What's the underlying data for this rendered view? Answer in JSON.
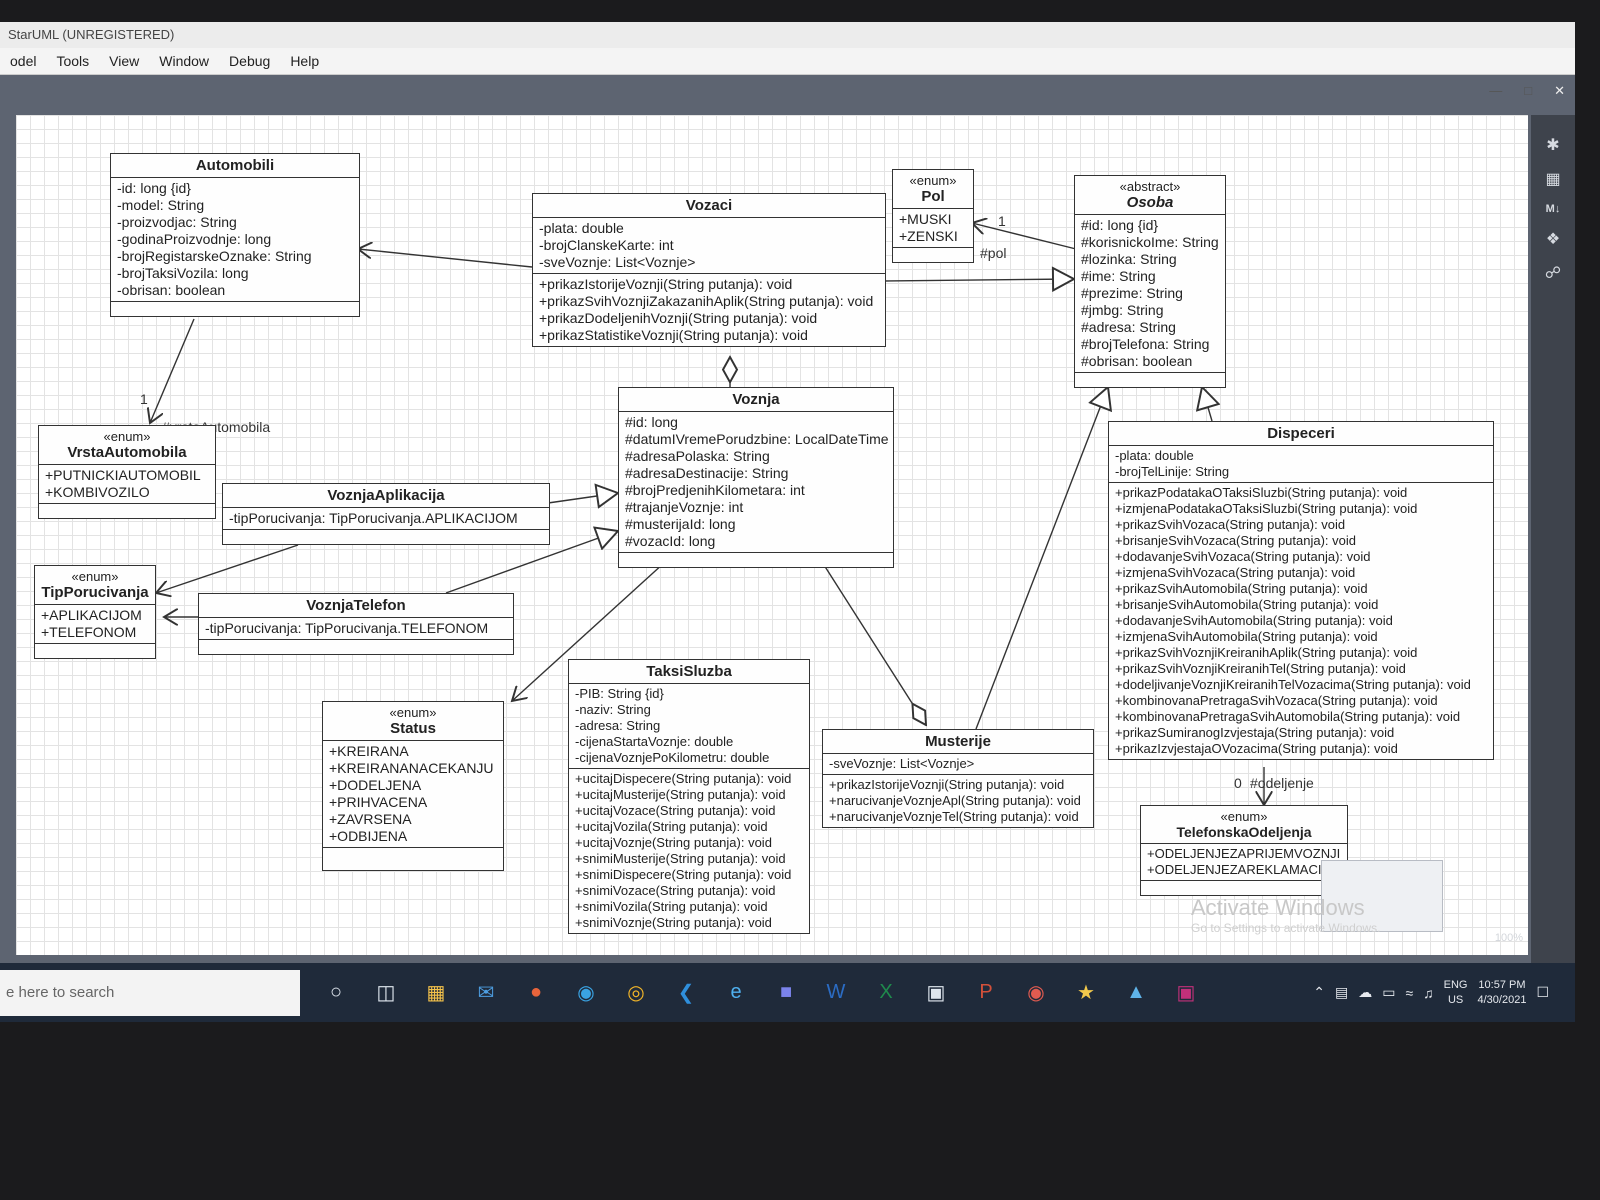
{
  "window": {
    "title": "StarUML (UNREGISTERED)",
    "menu": [
      "odel",
      "Tools",
      "View",
      "Window",
      "Debug",
      "Help"
    ]
  },
  "classes": {
    "automobili": {
      "name": "Automobili",
      "attributes": [
        "-id: long {id}",
        "-model: String",
        "-proizvodjac: String",
        "-godinaProizvodnje: long",
        "-brojRegistarskeOznake: String",
        "-brojTaksiVozila: long",
        "-obrisan: boolean"
      ]
    },
    "vozaci": {
      "name": "Vozaci",
      "attributes": [
        "-plata: double",
        "-brojClanskeKarte: int",
        "-sveVoznje: List<Voznje>"
      ],
      "operations": [
        "+prikazIstorijeVoznji(String putanja): void",
        "+prikazSvihVoznjiZakazanihAplik(String putanja): void",
        "+prikazDodeljenihVoznji(String putanja): void",
        "+prikazStatistikeVoznji(String putanja): void"
      ]
    },
    "pol": {
      "stereotype": "«enum»",
      "name": "Pol",
      "literals": [
        "+MUSKI",
        "+ZENSKI"
      ]
    },
    "osoba": {
      "stereotype": "«abstract»",
      "name": "Osoba",
      "attributes": [
        "#id: long {id}",
        "#korisnickoIme: String",
        "#lozinka: String",
        "#ime: String",
        "#prezime: String",
        "#jmbg: String",
        "#adresa: String",
        "#brojTelefona: String",
        "#obrisan: boolean"
      ]
    },
    "vrstaAutomobila": {
      "stereotype": "«enum»",
      "name": "VrstaAutomobila",
      "literals": [
        "+PUTNICKIAUTOMOBIL",
        "+KOMBIVOZILO"
      ]
    },
    "voznja": {
      "name": "Voznja",
      "attributes": [
        "#id: long",
        "#datumIVremePorudzbine: LocalDateTime",
        "#adresaPolaska: String",
        "#adresaDestinacije: String",
        "#brojPredjenihKilometara: int",
        "#trajanjeVoznje: int",
        "#musterijaId: long",
        "#vozacId: long"
      ]
    },
    "voznjaAplikacija": {
      "name": "VoznjaAplikacija",
      "attributes": [
        "-tipPorucivanja: TipPorucivanja.APLIKACIJOM"
      ]
    },
    "tipPorucivanja": {
      "stereotype": "«enum»",
      "name": "TipPorucivanja",
      "literals": [
        "+APLIKACIJOM",
        "+TELEFONOM"
      ]
    },
    "voznjaTelefon": {
      "name": "VoznjaTelefon",
      "attributes": [
        "-tipPorucivanja: TipPorucivanja.TELEFONOM"
      ]
    },
    "dispeceri": {
      "name": "Dispeceri",
      "attributes": [
        "-plata: double",
        "-brojTelLinije: String"
      ],
      "operations": [
        "+prikazPodatakaOTaksiSluzbi(String putanja): void",
        "+izmjenaPodatakaOTaksiSluzbi(String putanja): void",
        "+prikazSvihVozaca(String putanja): void",
        "+brisanjeSvihVozaca(String putanja): void",
        "+dodavanjeSvihVozaca(String putanja): void",
        "+izmjenaSvihVozaca(String putanja): void",
        "+prikazSvihAutomobila(String putanja): void",
        "+brisanjeSvihAutomobila(String putanja): void",
        "+dodavanjeSvihAutomobila(String putanja): void",
        "+izmjenaSvihAutomobila(String putanja): void",
        "+prikazSvihVoznjiKreiranihAplik(String putanja): void",
        "+prikazSvihVoznjiKreiranihTel(String putanja): void",
        "+dodeljivanjeVoznjiKreiranihTelVozacima(String putanja): void",
        "+kombinovanaPretragaSvihVozaca(String putanja): void",
        "+kombinovanaPretragaSvihAutomobila(String putanja): void",
        "+prikazSumiranogIzvjestaja(String putanja): void",
        "+prikazIzvjestajaOVozacima(String putanja): void"
      ]
    },
    "status": {
      "stereotype": "«enum»",
      "name": "Status",
      "literals": [
        "+KREIRANA",
        "+KREIRANANACEKANJU",
        "+DODELJENA",
        "+PRIHVACENA",
        "+ZAVRSENA",
        "+ODBIJENA"
      ]
    },
    "taksiSluzba": {
      "name": "TaksiSluzba",
      "attributes": [
        "-PIB: String {id}",
        "-naziv: String",
        "-adresa: String",
        "-cijenaStartaVoznje: double",
        "-cijenaVoznjePoKilometru: double"
      ],
      "operations": [
        "+ucitajDispecere(String putanja): void",
        "+ucitajMusterije(String putanja): void",
        "+ucitajVozace(String putanja): void",
        "+ucitajVozila(String putanja): void",
        "+ucitajVoznje(String putanja): void",
        "+snimiMusterije(String putanja): void",
        "+snimiDispecere(String putanja): void",
        "+snimiVozace(String putanja): void",
        "+snimiVozila(String putanja): void",
        "+snimiVoznje(String putanja): void"
      ]
    },
    "musterije": {
      "name": "Musterije",
      "attributes": [
        "-sveVoznje: List<Voznje>"
      ],
      "operations": [
        "+prikazIstorijeVoznji(String putanja): void",
        "+narucivanjeVoznjeApl(String putanja): void",
        "+narucivanjeVoznjeTel(String putanja): void"
      ]
    },
    "telefonskaOdeljenja": {
      "stereotype": "«enum»",
      "name": "TelefonskaOdeljenja",
      "literals": [
        "+ODELJENJEZAPRIJEMVOZNJI",
        "+ODELJENJEZAREKLAMACIJ"
      ]
    }
  },
  "association_labels": {
    "vrsta_mult": "1",
    "vrsta_role": "#vrstaAutomobila",
    "pol_mult": "1",
    "pol_role": "#pol",
    "odeljenje_mult": "0",
    "odeljenje_role": "#odeljenje"
  },
  "watermark": {
    "line1": "Activate Windows",
    "line2": "Go to Settings to activate Windows."
  },
  "zoom": "100%",
  "taskbar": {
    "search_placeholder": "e here to search",
    "icons": [
      "cortana-icon",
      "task-view-icon",
      "file-explorer-icon",
      "mail-icon",
      "media-icon",
      "edge-icon",
      "chrome-icon",
      "vscode-icon",
      "ie-icon",
      "teams-icon",
      "word-icon",
      "excel-icon",
      "store-icon",
      "powerpoint-icon",
      "app-icon",
      "staruml-icon",
      "photos-icon",
      "remote-icon"
    ],
    "lang_top": "ENG",
    "lang_bottom": "US",
    "time": "10:57 PM",
    "date": "4/30/2021"
  }
}
